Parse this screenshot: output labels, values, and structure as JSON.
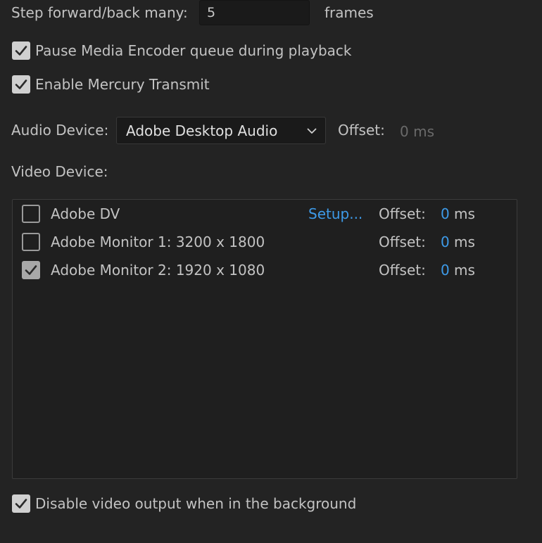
{
  "step": {
    "label": "Step forward/back many:",
    "value": "5",
    "unit": "frames"
  },
  "options": {
    "pause_encoder": {
      "label": "Pause Media Encoder queue during playback",
      "checked": true
    },
    "mercury_transmit": {
      "label": "Enable Mercury Transmit",
      "checked": true
    },
    "disable_background": {
      "label": "Disable video output when in the background",
      "checked": true
    }
  },
  "audio": {
    "label": "Audio Device:",
    "selected": "Adobe Desktop Audio",
    "offset_label": "Offset:",
    "offset_value": "0 ms"
  },
  "video": {
    "label": "Video Device:",
    "devices": [
      {
        "name": "Adobe DV",
        "checked": false,
        "setup_label": "Setup...",
        "offset_label": "Offset:",
        "offset_value": "0",
        "offset_unit": "ms"
      },
      {
        "name": "Adobe Monitor 1: 3200 x 1800",
        "checked": false,
        "offset_label": "Offset:",
        "offset_value": "0",
        "offset_unit": "ms"
      },
      {
        "name": "Adobe Monitor 2: 1920 x 1080",
        "checked": true,
        "offset_label": "Offset:",
        "offset_value": "0",
        "offset_unit": "ms"
      }
    ]
  },
  "colors": {
    "background": "#232323",
    "text": "#c3c3c3",
    "accent_blue": "#3d9ae8",
    "muted": "#6a6a6a"
  }
}
